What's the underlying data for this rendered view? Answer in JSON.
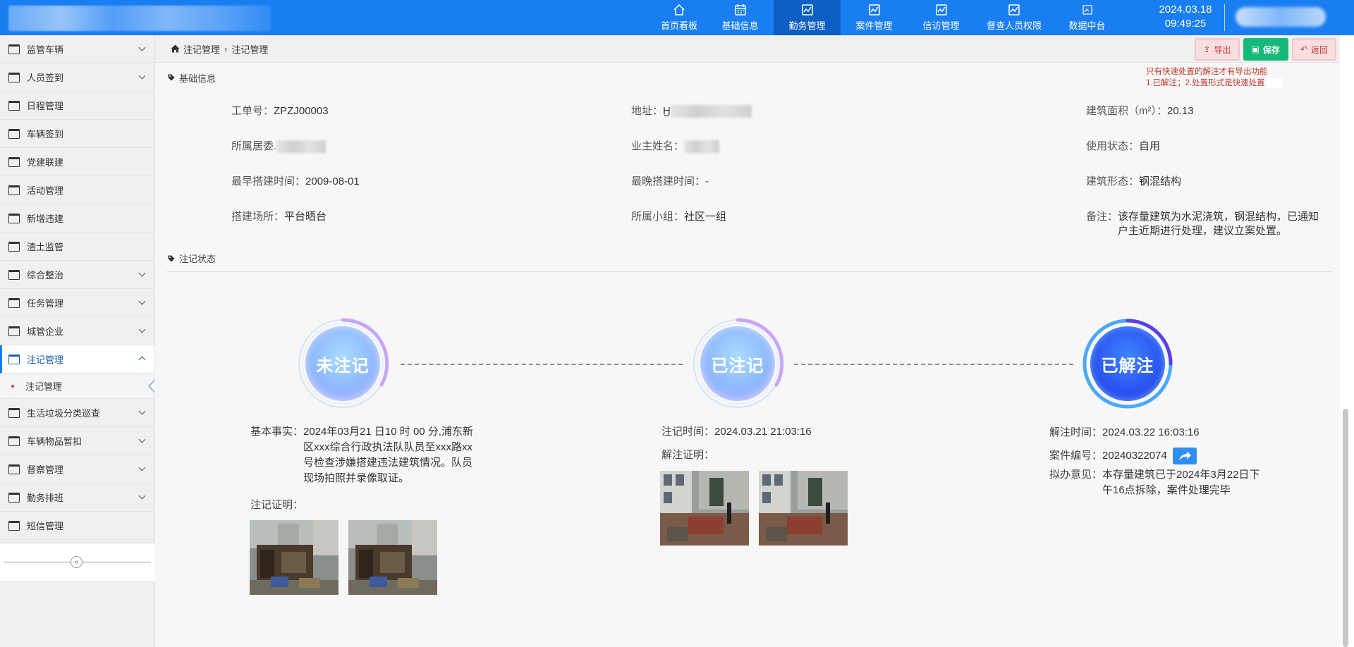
{
  "header": {
    "nav": [
      {
        "label": "首页看板",
        "icon": "home-icon"
      },
      {
        "label": "基础信息",
        "icon": "calendar-icon"
      },
      {
        "label": "勤务管理",
        "icon": "chart-icon",
        "active": true
      },
      {
        "label": "案件管理",
        "icon": "chart-icon"
      },
      {
        "label": "信访管理",
        "icon": "chart-icon"
      },
      {
        "label": "督查人员权限",
        "icon": "chart-icon"
      },
      {
        "label": "数据中台",
        "icon": "broken-image-icon"
      }
    ],
    "date": "2024.03.18",
    "time": "09:49:25"
  },
  "sidebar": {
    "items": [
      {
        "label": "监管车辆",
        "chevron": true
      },
      {
        "label": "人员签到",
        "chevron": true
      },
      {
        "label": "日程管理",
        "chevron": false
      },
      {
        "label": "车辆签到",
        "chevron": false
      },
      {
        "label": "党建联建",
        "chevron": false
      },
      {
        "label": "活动管理",
        "chevron": false
      },
      {
        "label": "新增违建",
        "chevron": false
      },
      {
        "label": "渣土监管",
        "chevron": false
      },
      {
        "label": "综合整治",
        "chevron": true
      },
      {
        "label": "任务管理",
        "chevron": true
      },
      {
        "label": "城管企业",
        "chevron": true
      },
      {
        "label": "注记管理",
        "chevron": true,
        "active": true
      }
    ],
    "sub_item": "注记管理",
    "items_after": [
      {
        "label": "生活垃圾分类巡查",
        "chevron": true
      },
      {
        "label": "车辆物品暂扣",
        "chevron": true
      },
      {
        "label": "督察管理",
        "chevron": true
      },
      {
        "label": "勤务排班",
        "chevron": true
      },
      {
        "label": "短信管理",
        "chevron": false
      }
    ],
    "collapse_glyph": "«"
  },
  "breadcrumb": {
    "root": "注记管理",
    "sep": "›",
    "current": "注记管理"
  },
  "actions": {
    "export": "导出",
    "save": "保存",
    "back": "返回"
  },
  "hint": {
    "line1": "只有快速处置的解注才有导出功能",
    "line2": "1.已解注；2.处置形式是快速处置"
  },
  "basic": {
    "title": "基础信息",
    "order_label": "工单号：",
    "order_value": "ZPZJ00003",
    "address_label": "地址：",
    "address_prefix": "Ӈ",
    "area_label": "建筑面积（m²）：",
    "area_value": "20.13",
    "committee_label": "所属居委.",
    "owner_label": "业主姓名：",
    "use_label": "使用状态：",
    "use_value": "自用",
    "earliest_label": "最早搭建时间：",
    "earliest_value": "2009-08-01",
    "latest_label": "最晚搭建时间：",
    "latest_value": "-",
    "form_label": "建筑形态：",
    "form_value": "钢混结构",
    "place_label": "搭建场所：",
    "place_value": "平台晒台",
    "group_label": "所属小组：",
    "group_value": "社区一组",
    "remark_label": "备注：",
    "remark_value": "该存量建筑为水泥浇筑，钢混结构，已通知户主近期进行处理，建议立案处置。"
  },
  "status": {
    "title": "注记状态",
    "nodes": [
      {
        "label": "未注记",
        "state": "pending"
      },
      {
        "label": "已注记",
        "state": "pending"
      },
      {
        "label": "已解注",
        "state": "active"
      }
    ],
    "col1": {
      "fact_label": "基本事实：",
      "fact_value": "2024年03月21 日10 时 00 分,浦东新区xxx综合行政执法队队员至xxx路xx号检查涉嫌搭建违法建筑情况。队员现场拍照并录像取证。",
      "proof_label": "注记证明："
    },
    "col2": {
      "time_label": "注记时间：",
      "time_value": "2024.03.21 21:03:16",
      "proof_label": "解注证明："
    },
    "col3": {
      "time_label": "解注时间：",
      "time_value": "2024.03.22 16:03:16",
      "case_label": "案件编号：",
      "case_value": "20240322074",
      "opinion_label": "拟办意见：",
      "opinion_value": "本存量建筑已于2024年3月22日下午16点拆除，案件处理完毕"
    }
  },
  "colors": {
    "topbar": "#1a7ef3",
    "nav_active": "#0d5fc4",
    "save": "#17b978",
    "danger": "#c0392b"
  }
}
